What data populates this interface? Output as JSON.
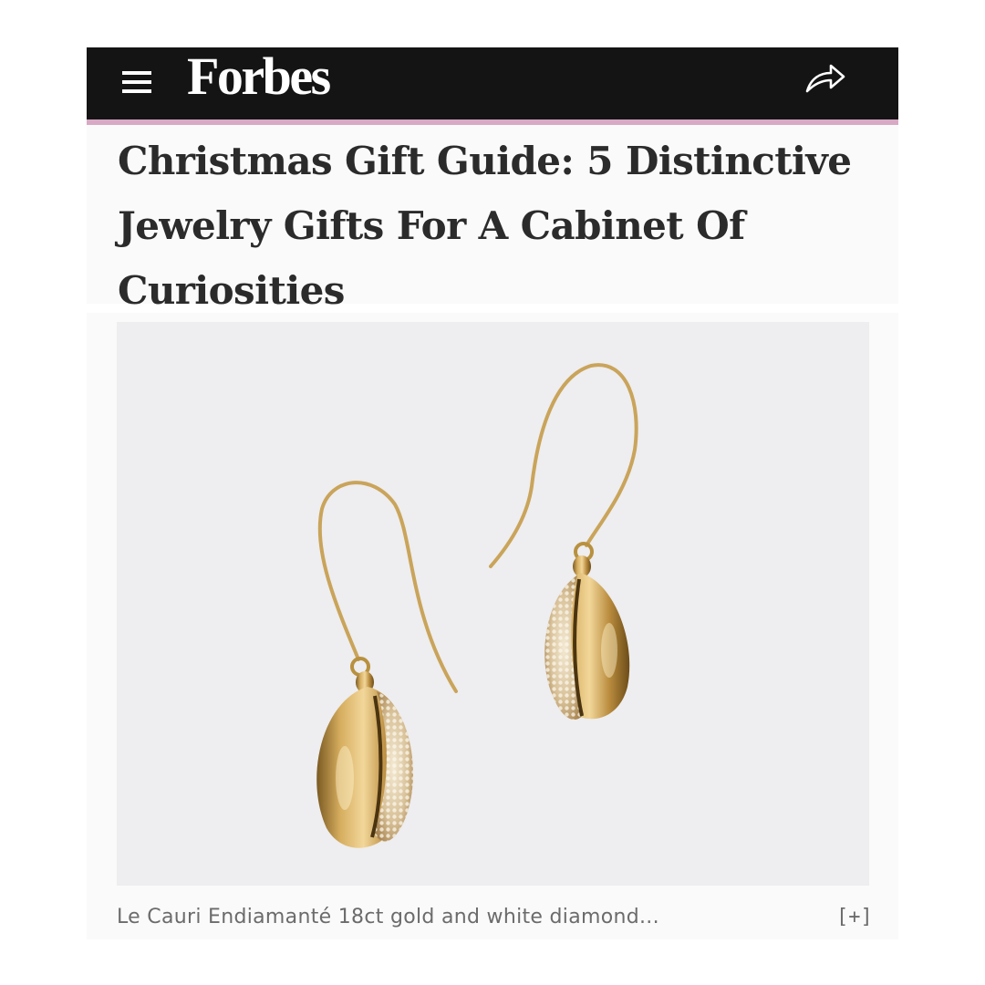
{
  "header": {
    "logo_text": "Forbes",
    "menu_icon": "hamburger-menu-icon",
    "share_icon": "share-arrow-icon",
    "background_color": "#141414",
    "accent_color": "#d8a9c4"
  },
  "article": {
    "headline": "Christmas Gift Guide: 5 Distinctive Jewelry Gifts For A Cabinet Of Curiosities",
    "image": {
      "subject": "gold cowrie shell earrings with pavé diamonds",
      "background_color": "#eeedef"
    },
    "caption": "Le Cauri Endiamanté 18ct gold and white diamond...",
    "caption_expand_label": "[+]"
  }
}
